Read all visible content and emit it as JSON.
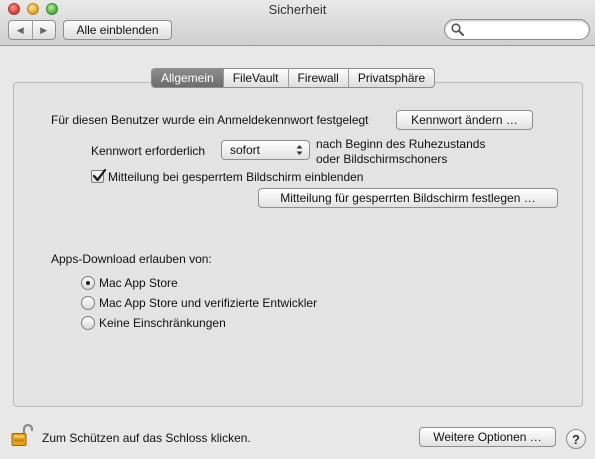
{
  "window": {
    "title": "Sicherheit"
  },
  "toolbar": {
    "back": "◀",
    "forward": "▶",
    "show_all": "Alle einblenden",
    "search_placeholder": ""
  },
  "tabs": [
    "Allgemein",
    "FileVault",
    "Firewall",
    "Privatsphäre"
  ],
  "general": {
    "password_set_text": "Für diesen Benutzer wurde ein Anmeldekennwort festgelegt",
    "change_password_button": "Kennwort ändern …",
    "require_password_label": "Kennwort erforderlich",
    "require_password_value": "sofort",
    "require_password_suffix_1": "nach Beginn des Ruhezustands",
    "require_password_suffix_2": "oder Bildschirmschoners",
    "show_message_label": "Mitteilung bei gesperrtem Bildschirm einblenden",
    "show_message_checked": true,
    "set_message_button": "Mitteilung für gesperrten Bildschirm festlegen …"
  },
  "downloads": {
    "heading": "Apps-Download erlauben von:",
    "options": [
      {
        "label": "Mac App Store",
        "selected": true
      },
      {
        "label": "Mac App Store und verifizierte Entwickler",
        "selected": false
      },
      {
        "label": "Keine Einschränkungen",
        "selected": false
      }
    ]
  },
  "footer": {
    "lock_text": "Zum Schützen auf das Schloss klicken.",
    "advanced_button": "Weitere Optionen …",
    "help_label": "?"
  }
}
